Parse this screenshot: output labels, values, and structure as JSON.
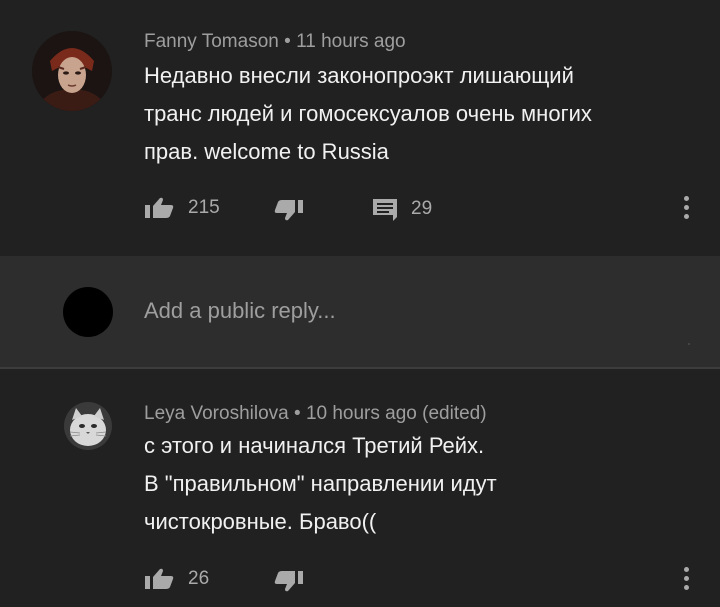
{
  "comments": [
    {
      "author": "Fanny Tomason",
      "time": "11 hours ago",
      "lines": [
        "Недавно внесли законопроэкт лишающий",
        "транс людей и гомосексуалов очень многих",
        "прав. welcome to Russia"
      ],
      "likes": "215",
      "replies": "29"
    },
    {
      "author": "Leya Voroshilova",
      "time": "10 hours ago (edited)",
      "lines": [
        "с этого и начинался Третий Рейх.",
        "В \"правильном\" направлении идут",
        "чистокровные. Браво(("
      ],
      "likes": "26"
    }
  ],
  "reply_box": {
    "placeholder": "Add a public reply..."
  },
  "separator": "•",
  "icons": {
    "like": "thumb-up-icon",
    "dislike": "thumb-down-icon",
    "reply": "comment-icon",
    "more": "more-vertical-icon"
  },
  "colors": {
    "background": "#212121",
    "reply_background": "#2d2d2d",
    "text": "#f1f1f1",
    "meta_text": "#9e9e9e",
    "icon": "#aaaaaa"
  }
}
